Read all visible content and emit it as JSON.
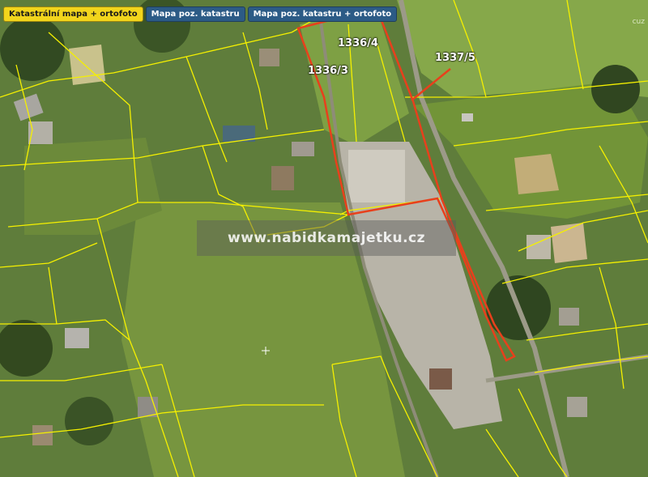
{
  "tabs": [
    {
      "label": "Katastrální mapa + ortofoto",
      "active": true
    },
    {
      "label": "Mapa poz. katastru",
      "active": false
    },
    {
      "label": "Mapa poz. katastru + ortofoto",
      "active": false
    }
  ],
  "parcels": {
    "p1336_4": "1336/4",
    "p1336_3": "1336/3",
    "p1337_5": "1337/5"
  },
  "watermark": "www.nabidkamajetku.cz",
  "corner_text": "cuz",
  "colors": {
    "parcel_line": "#f5f000",
    "highlight": "#e8401c",
    "tab_active": "#f2d51c",
    "tab": "#2c5b86"
  }
}
